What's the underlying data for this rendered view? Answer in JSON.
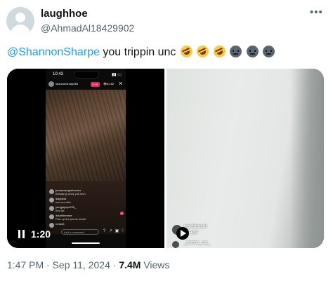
{
  "author": {
    "display_name": "laughhoe",
    "handle": "@AhmadAl18429902"
  },
  "tweet": {
    "mention": "@ShannonSharpe",
    "text": " you trippin unc",
    "emojis": [
      "rofl",
      "rofl",
      "rofl",
      "neutral-face",
      "neutral-face",
      "neutral-face"
    ]
  },
  "more_icon": "more-dots-icon",
  "video_left": {
    "status_time": "10:43",
    "stream_user": "shannonsharpe84",
    "live_label": "LIVE",
    "viewer_count": "8,182",
    "comments": [
      {
        "user": "jordanvaughnbrooks",
        "text": "Breaking news y'all tech"
      },
      {
        "user": "diagnkid",
        "text": "unc era with"
      },
      {
        "user": "yungjayhya795_",
        "text": "Bro wtf"
      },
      {
        "user": "ddubbheeme",
        "text": "Pick up the phone bruhh"
      },
      {
        "user": "ruhdd3",
        "text": ""
      }
    ],
    "comment_placeholder": "Add a comment...",
    "time": "1:20",
    "colors": {
      "live_badge": "#e0245e",
      "heart": "#ff4d88"
    }
  },
  "video_right": {
    "comments": [
      {
        "user": "trashboiab",
        "text": "WHAT"
      },
      {
        "user": "_horns_up_",
        "text": ""
      }
    ]
  },
  "meta": {
    "time": "1:47 PM",
    "separator": " · ",
    "date": "Sep 11, 2024",
    "views_count": "7.4M",
    "views_label": " Views"
  },
  "colors": {
    "link": "#1d9bf0",
    "secondary_text": "#536471",
    "primary_text": "#0f1419"
  }
}
